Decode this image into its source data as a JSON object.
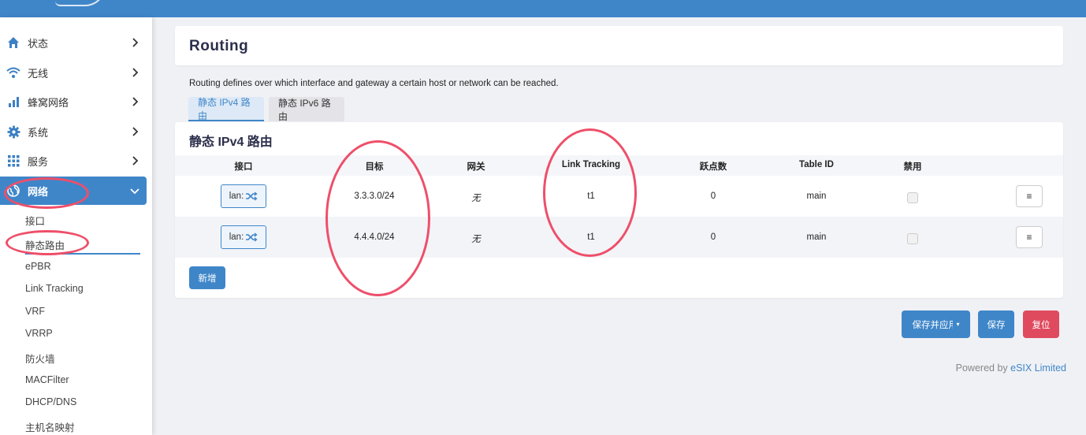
{
  "sidebar": {
    "items": [
      {
        "label": "状态",
        "icon": "home-icon"
      },
      {
        "label": "无线",
        "icon": "wifi-icon"
      },
      {
        "label": "蜂窝网络",
        "icon": "signal-bars-icon"
      },
      {
        "label": "系统",
        "icon": "gear-icon"
      },
      {
        "label": "服务",
        "icon": "grid-icon"
      },
      {
        "label": "网络",
        "icon": "globe-icon"
      }
    ],
    "sub_items": [
      "接口",
      "静态路由",
      "ePBR",
      "Link Tracking",
      "VRF",
      "VRRP",
      "防火墙",
      "MACFilter",
      "DHCP/DNS",
      "主机名映射"
    ]
  },
  "page": {
    "title": "Routing",
    "description": "Routing defines over which interface and gateway a certain host or network can be reached."
  },
  "tabs": [
    "静态 IPv4 路由",
    "静态 IPv6 路由"
  ],
  "section": {
    "title": "静态 IPv4 路由",
    "columns": [
      "接口",
      "目标",
      "网关",
      "Link Tracking",
      "跃点数",
      "Table ID",
      "禁用"
    ],
    "rows": [
      {
        "interface": "lan:",
        "target": "3.3.3.0/24",
        "gateway": "无",
        "link_tracking": "t1",
        "metric": "0",
        "table_id": "main",
        "menu": "≡"
      },
      {
        "interface": "lan:",
        "target": "4.4.4.0/24",
        "gateway": "无",
        "link_tracking": "t1",
        "metric": "0",
        "table_id": "main",
        "menu": "≡"
      }
    ],
    "add_label": "新增"
  },
  "actions": {
    "save_apply": "保存并应用",
    "save": "保存",
    "reset": "复位"
  },
  "footer": {
    "prefix": "Powered by ",
    "link": "eSIX Limited"
  },
  "colors": {
    "accent": "#3f86c9",
    "danger": "#e04a5e",
    "annotation": "#ee4f6a"
  }
}
